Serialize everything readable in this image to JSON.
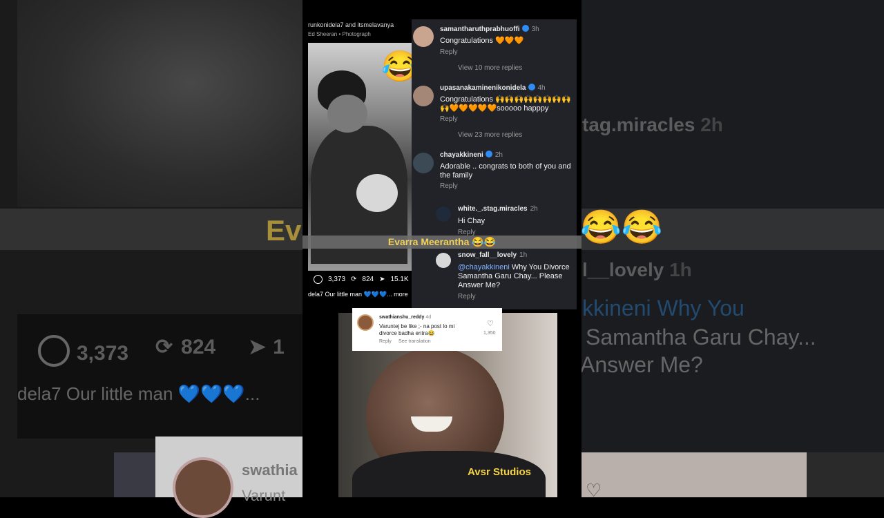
{
  "background": {
    "left_stats": {
      "comments": "3,373",
      "reposts": "824",
      "shares_partial": "1"
    },
    "left_caption": "dela7 Our little man 💙💙💙...",
    "band_text_left": "Ev",
    "band_emoji_right": "😂😂",
    "right_name_1": "tag.miracles",
    "right_time_1": "2h",
    "right_name_2": "l__lovely",
    "right_time_2": "1h",
    "right_text_1": "kkineni Why You",
    "right_text_2": "Samantha Garu Chay...",
    "right_text_3": "Answer Me?",
    "bottom_name": "swathia",
    "bottom_text": "Varunt"
  },
  "post": {
    "author": "runkonidela7 and itsmelavanya",
    "music": "Ed Sheeran • Photograph",
    "stats": {
      "comments": "3,373",
      "reposts": "824",
      "shares": "15.1K"
    },
    "caption": "dela7 Our little man 💙💙💙... more",
    "overlay_emoji": "😂"
  },
  "comments": [
    {
      "user": "samantharuthprabhuoffi",
      "verified": true,
      "time": "3h",
      "text": "Congratulations 🧡🧡🧡",
      "reply": "Reply",
      "more": "View 10 more replies"
    },
    {
      "user": "upasanakaminenikonidela",
      "verified": true,
      "time": "4h",
      "text": "Congratulations 🙌🙌🙌🙌🙌🙌🙌🙌🙌🧡🧡🧡🧡🧡sooooo happpy",
      "reply": "Reply",
      "more": "View 23 more replies"
    },
    {
      "user": "chayakkineni",
      "verified": true,
      "time": "2h",
      "text": "Adorable .. congrats to both of you and the family",
      "reply": "Reply"
    },
    {
      "user": "white._.stag.miracles",
      "verified": false,
      "time": "2h",
      "text": "Hi Chay",
      "reply": "Reply"
    },
    {
      "user": "snow_fall__lovely",
      "verified": false,
      "time": "1h",
      "mention": "@chayakkineni",
      "text": " Why You Divorce Samantha Garu Chay... Please Answer Me?",
      "reply": "Reply"
    }
  ],
  "overlay_caption": "Evarra Meerantha 😂😂",
  "ig_comment": {
    "user": "swathianshu_reddy",
    "time": "4d",
    "text": "Varuntej be like ;- na post lo mi divorce badha entra😂",
    "reply": "Reply",
    "see_translation": "See translation",
    "likes": "1,350"
  },
  "watermark": "Avsr Studios",
  "colors": {
    "accent": "#f5d34b",
    "verified": "#2f8bf5",
    "panel": "#212329"
  }
}
